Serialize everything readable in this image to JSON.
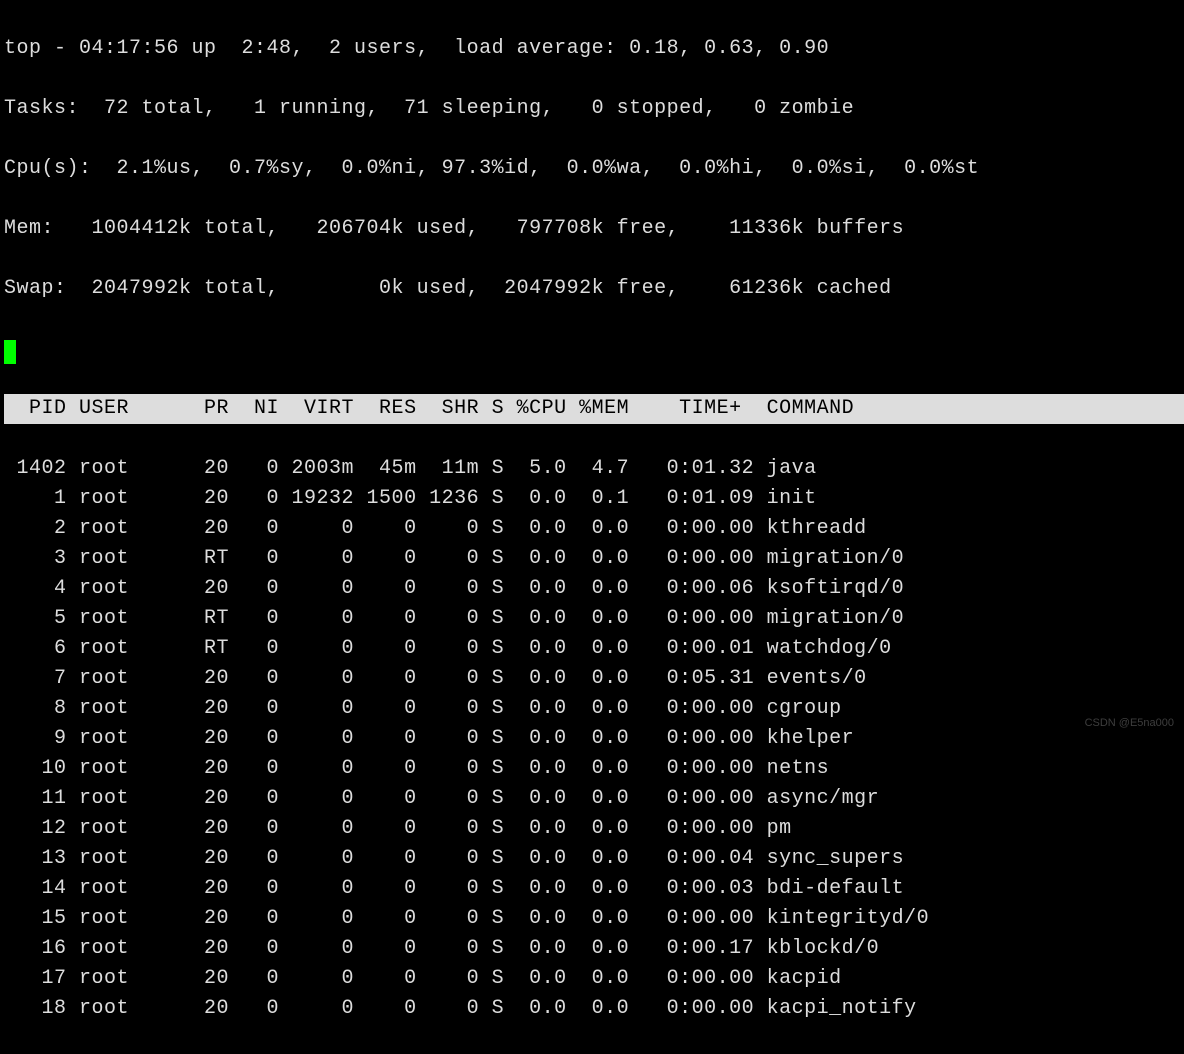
{
  "summary": {
    "line1": "top - 04:17:56 up  2:48,  2 users,  load average: 0.18, 0.63, 0.90",
    "line2": "Tasks:  72 total,   1 running,  71 sleeping,   0 stopped,   0 zombie",
    "line3": "Cpu(s):  2.1%us,  0.7%sy,  0.0%ni, 97.3%id,  0.0%wa,  0.0%hi,  0.0%si,  0.0%st",
    "line4": "Mem:   1004412k total,   206704k used,   797708k free,    11336k buffers",
    "line5": "Swap:  2047992k total,        0k used,  2047992k free,    61236k cached"
  },
  "columns": {
    "header": "  PID USER      PR  NI  VIRT  RES  SHR S %CPU %MEM    TIME+  COMMAND          "
  },
  "processes": [
    {
      "pid": "1402",
      "user": "root",
      "pr": "20",
      "ni": "0",
      "virt": "2003m",
      "res": "45m",
      "shr": "11m",
      "s": "S",
      "cpu": "5.0",
      "mem": "4.7",
      "time": "0:01.32",
      "command": "java"
    },
    {
      "pid": "1",
      "user": "root",
      "pr": "20",
      "ni": "0",
      "virt": "19232",
      "res": "1500",
      "shr": "1236",
      "s": "S",
      "cpu": "0.0",
      "mem": "0.1",
      "time": "0:01.09",
      "command": "init"
    },
    {
      "pid": "2",
      "user": "root",
      "pr": "20",
      "ni": "0",
      "virt": "0",
      "res": "0",
      "shr": "0",
      "s": "S",
      "cpu": "0.0",
      "mem": "0.0",
      "time": "0:00.00",
      "command": "kthreadd"
    },
    {
      "pid": "3",
      "user": "root",
      "pr": "RT",
      "ni": "0",
      "virt": "0",
      "res": "0",
      "shr": "0",
      "s": "S",
      "cpu": "0.0",
      "mem": "0.0",
      "time": "0:00.00",
      "command": "migration/0"
    },
    {
      "pid": "4",
      "user": "root",
      "pr": "20",
      "ni": "0",
      "virt": "0",
      "res": "0",
      "shr": "0",
      "s": "S",
      "cpu": "0.0",
      "mem": "0.0",
      "time": "0:00.06",
      "command": "ksoftirqd/0"
    },
    {
      "pid": "5",
      "user": "root",
      "pr": "RT",
      "ni": "0",
      "virt": "0",
      "res": "0",
      "shr": "0",
      "s": "S",
      "cpu": "0.0",
      "mem": "0.0",
      "time": "0:00.00",
      "command": "migration/0"
    },
    {
      "pid": "6",
      "user": "root",
      "pr": "RT",
      "ni": "0",
      "virt": "0",
      "res": "0",
      "shr": "0",
      "s": "S",
      "cpu": "0.0",
      "mem": "0.0",
      "time": "0:00.01",
      "command": "watchdog/0"
    },
    {
      "pid": "7",
      "user": "root",
      "pr": "20",
      "ni": "0",
      "virt": "0",
      "res": "0",
      "shr": "0",
      "s": "S",
      "cpu": "0.0",
      "mem": "0.0",
      "time": "0:05.31",
      "command": "events/0"
    },
    {
      "pid": "8",
      "user": "root",
      "pr": "20",
      "ni": "0",
      "virt": "0",
      "res": "0",
      "shr": "0",
      "s": "S",
      "cpu": "0.0",
      "mem": "0.0",
      "time": "0:00.00",
      "command": "cgroup"
    },
    {
      "pid": "9",
      "user": "root",
      "pr": "20",
      "ni": "0",
      "virt": "0",
      "res": "0",
      "shr": "0",
      "s": "S",
      "cpu": "0.0",
      "mem": "0.0",
      "time": "0:00.00",
      "command": "khelper"
    },
    {
      "pid": "10",
      "user": "root",
      "pr": "20",
      "ni": "0",
      "virt": "0",
      "res": "0",
      "shr": "0",
      "s": "S",
      "cpu": "0.0",
      "mem": "0.0",
      "time": "0:00.00",
      "command": "netns"
    },
    {
      "pid": "11",
      "user": "root",
      "pr": "20",
      "ni": "0",
      "virt": "0",
      "res": "0",
      "shr": "0",
      "s": "S",
      "cpu": "0.0",
      "mem": "0.0",
      "time": "0:00.00",
      "command": "async/mgr"
    },
    {
      "pid": "12",
      "user": "root",
      "pr": "20",
      "ni": "0",
      "virt": "0",
      "res": "0",
      "shr": "0",
      "s": "S",
      "cpu": "0.0",
      "mem": "0.0",
      "time": "0:00.00",
      "command": "pm"
    },
    {
      "pid": "13",
      "user": "root",
      "pr": "20",
      "ni": "0",
      "virt": "0",
      "res": "0",
      "shr": "0",
      "s": "S",
      "cpu": "0.0",
      "mem": "0.0",
      "time": "0:00.04",
      "command": "sync_supers"
    },
    {
      "pid": "14",
      "user": "root",
      "pr": "20",
      "ni": "0",
      "virt": "0",
      "res": "0",
      "shr": "0",
      "s": "S",
      "cpu": "0.0",
      "mem": "0.0",
      "time": "0:00.03",
      "command": "bdi-default"
    },
    {
      "pid": "15",
      "user": "root",
      "pr": "20",
      "ni": "0",
      "virt": "0",
      "res": "0",
      "shr": "0",
      "s": "S",
      "cpu": "0.0",
      "mem": "0.0",
      "time": "0:00.00",
      "command": "kintegrityd/0"
    },
    {
      "pid": "16",
      "user": "root",
      "pr": "20",
      "ni": "0",
      "virt": "0",
      "res": "0",
      "shr": "0",
      "s": "S",
      "cpu": "0.0",
      "mem": "0.0",
      "time": "0:00.17",
      "command": "kblockd/0"
    },
    {
      "pid": "17",
      "user": "root",
      "pr": "20",
      "ni": "0",
      "virt": "0",
      "res": "0",
      "shr": "0",
      "s": "S",
      "cpu": "0.0",
      "mem": "0.0",
      "time": "0:00.00",
      "command": "kacpid"
    },
    {
      "pid": "18",
      "user": "root",
      "pr": "20",
      "ni": "0",
      "virt": "0",
      "res": "0",
      "shr": "0",
      "s": "S",
      "cpu": "0.0",
      "mem": "0.0",
      "time": "0:00.00",
      "command": "kacpi_notify"
    }
  ],
  "watermark": "CSDN @E5na000"
}
